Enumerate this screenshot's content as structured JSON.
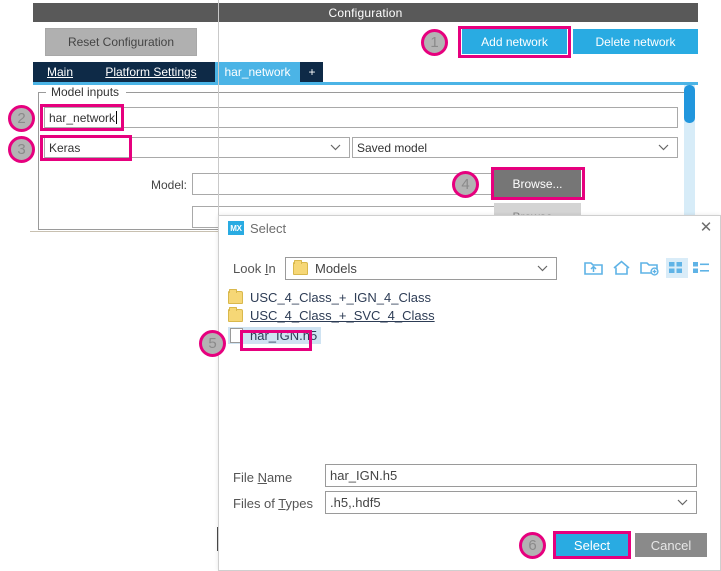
{
  "app": {
    "title": "Configuration",
    "reset_button": "Reset Configuration",
    "add_network_button": "Add network",
    "delete_network_button": "Delete network",
    "tabs": [
      {
        "label": "Main",
        "active": false
      },
      {
        "label": "Platform Settings",
        "active": false
      },
      {
        "label": "har_network",
        "active": true
      },
      {
        "label": "+",
        "active": false
      }
    ],
    "group": {
      "legend": "Model inputs",
      "network_name_value": "har_network",
      "framework_value": "Keras",
      "model_type_value": "Saved model",
      "model_label": "Model:",
      "model_path_value": "",
      "browse_button": "Browse...",
      "model_path_value_2": "",
      "browse_button_2": "Browse..."
    }
  },
  "dialog": {
    "title": "Select",
    "icon_label": "MX",
    "close_icon": "✕",
    "lookin_label": "Look In",
    "lookin_value": "Models",
    "toolbar": [
      {
        "name": "up-one-level-icon"
      },
      {
        "name": "home-icon"
      },
      {
        "name": "create-new-folder-icon"
      },
      {
        "name": "grid-view-icon"
      },
      {
        "name": "list-view-icon"
      }
    ],
    "files": [
      {
        "name": "USC_4_Class_+_IGN_4_Class",
        "type": "folder",
        "selected": false
      },
      {
        "name": "USC_4_Class_+_SVC_4_Class",
        "type": "folder",
        "selected": false
      },
      {
        "name": "har_IGN.h5",
        "type": "file",
        "selected": true
      }
    ],
    "filename_label": "File Name",
    "filename_value": "har_IGN.h5",
    "filetype_label": "Files of Types",
    "filetype_value": ".h5,.hdf5",
    "select_button": "Select",
    "cancel_button": "Cancel"
  },
  "callouts": {
    "c1": "1",
    "c2": "2",
    "c3": "3",
    "c4": "4",
    "c5": "5",
    "c6": "6"
  },
  "colors": {
    "accent_blue": "#29abe2",
    "tab_navy": "#0e2a47",
    "active_tab": "#4bb4e6",
    "titlebar_gray": "#595959",
    "highlight_magenta": "#e6007e",
    "callout_gray": "#b3b3b3",
    "folder_yellow": "#f6d776",
    "selection_blue": "#cfe3f2"
  },
  "glyphs": {
    "chevron_down": "⌄"
  }
}
